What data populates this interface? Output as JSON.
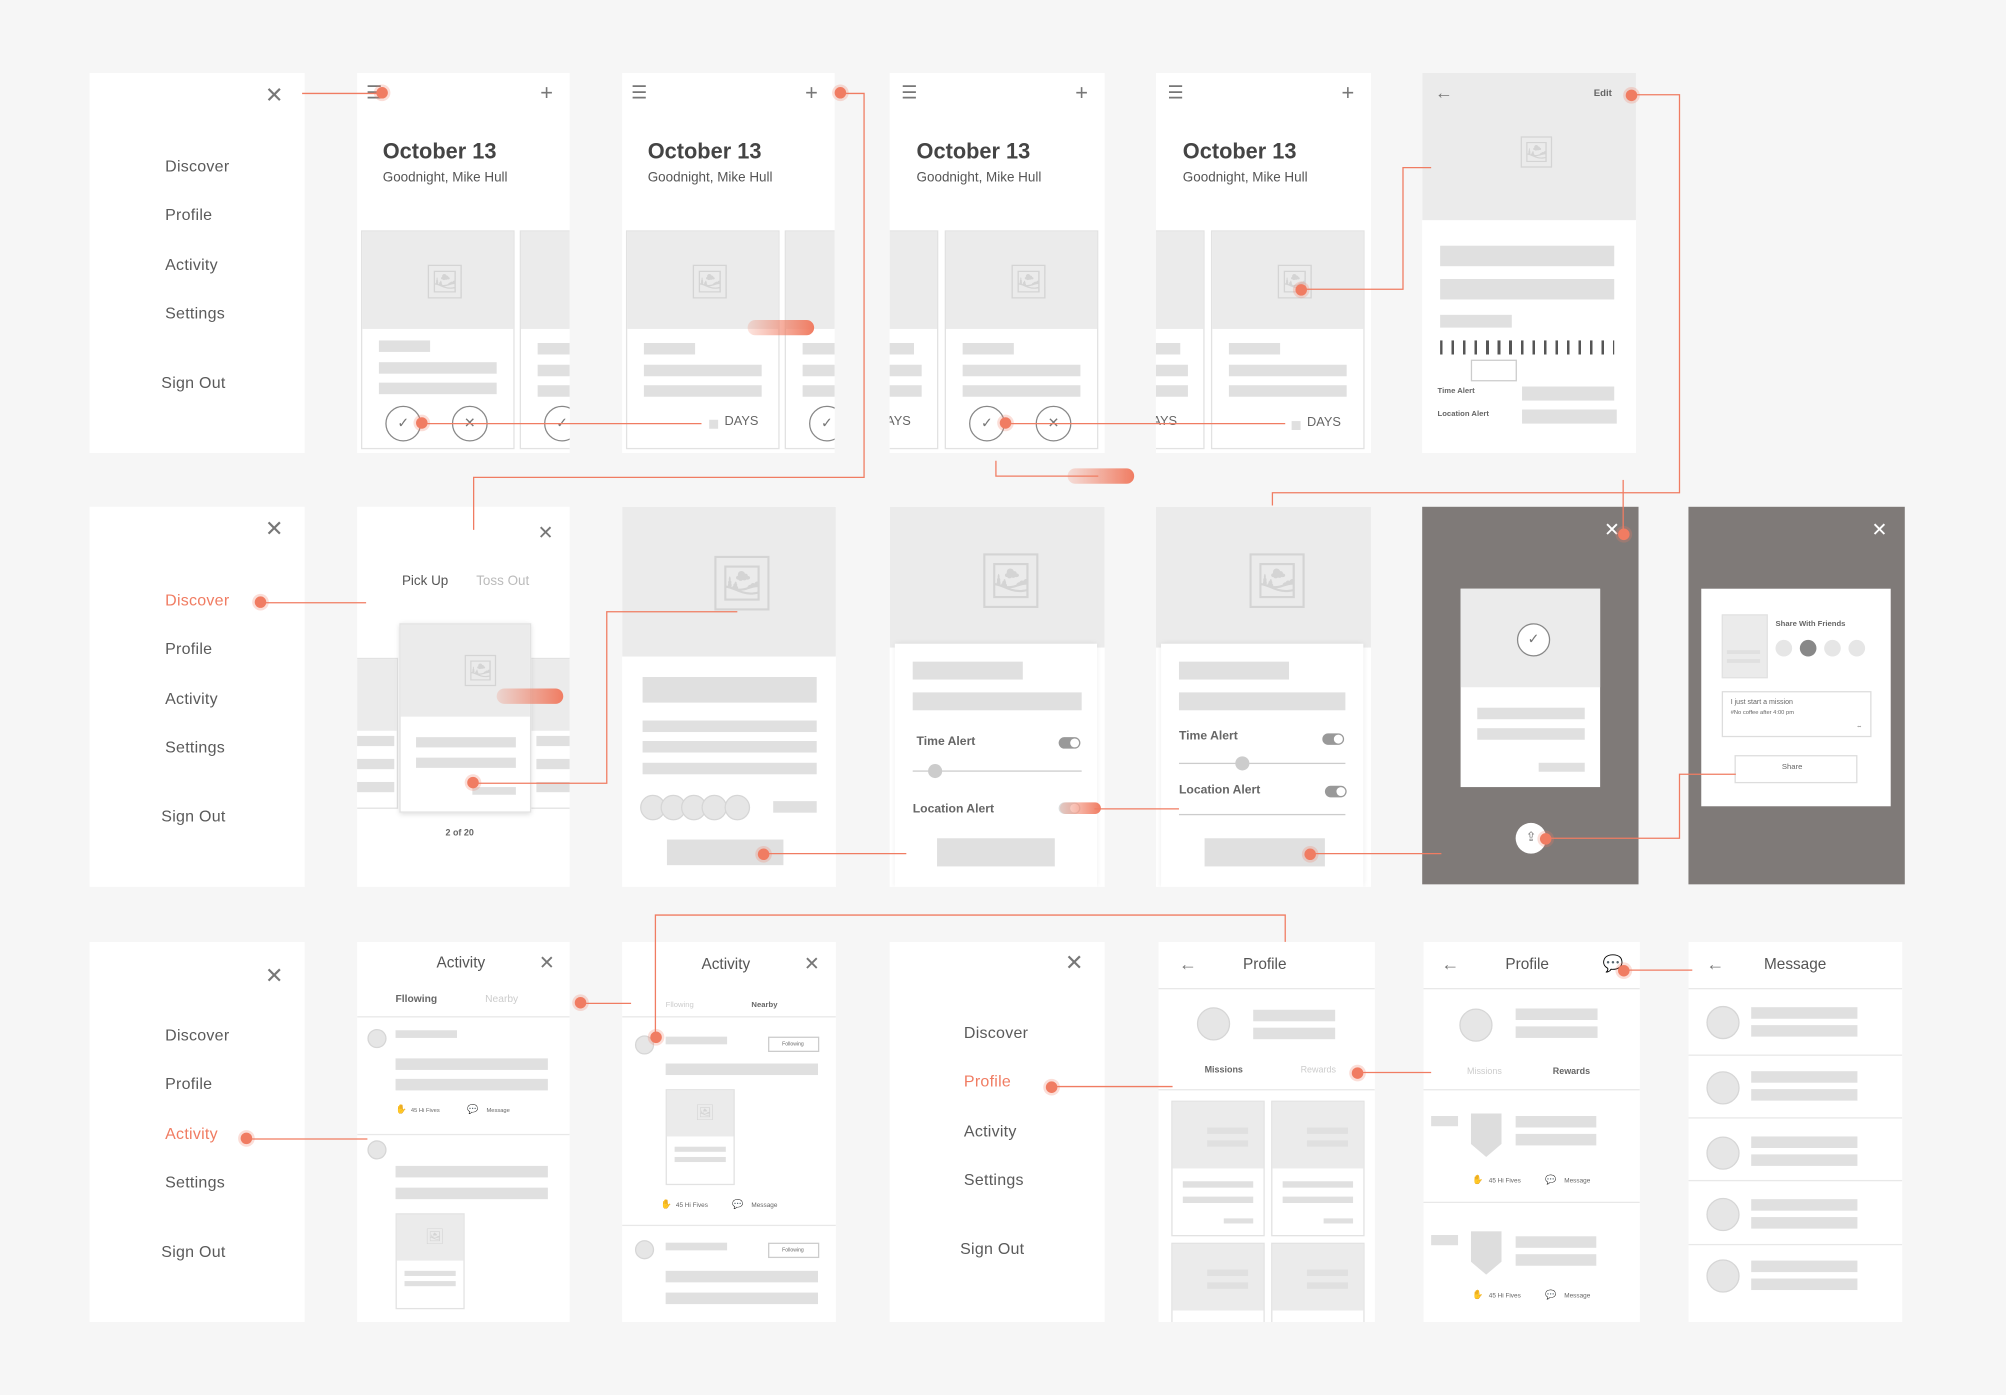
{
  "colors": {
    "accent": "#f07c62",
    "background": "#f6f6f6",
    "placeholder": "#e0e0e0",
    "overlay": "#7f7a78"
  },
  "menu": {
    "discover": "Discover",
    "profile": "Profile",
    "activity": "Activity",
    "settings": "Settings",
    "sign_out": "Sign Out"
  },
  "home": {
    "date": "October 13",
    "greeting": "Goodnight, Mike Hull",
    "days": "DAYS",
    "days_clipped": "DAYS"
  },
  "detail": {
    "edit": "Edit",
    "time_alert": "Time Alert",
    "location_alert": "Location Alert"
  },
  "pick": {
    "pick_up": "Pick Up",
    "toss_out": "Toss Out",
    "counter": "2 of 20"
  },
  "alerts": {
    "time_alert": "Time Alert",
    "location_alert": "Location Alert"
  },
  "share": {
    "title": "Share With Friends",
    "message_line1": "I just start a mission",
    "message_line2": "#No coffee after 4:00 pm",
    "share_button": "Share"
  },
  "activity": {
    "title": "Activity",
    "tab_following": "Fllowing",
    "tab_following_b": "Fllowing",
    "tab_nearby": "Nearby",
    "high_fives": "45 Hi Fives",
    "message": "Message",
    "following_badge": "Following"
  },
  "profile": {
    "title": "Profile",
    "missions": "Missions",
    "rewards": "Rewards",
    "high_fives": "45 Hi Fives",
    "message": "Message"
  },
  "message_screen": {
    "title": "Message"
  },
  "icons": [
    "close-icon",
    "menu-icon",
    "plus-icon",
    "back-icon",
    "image-icon",
    "check-icon",
    "chat-icon",
    "user-icon",
    "share-icon"
  ]
}
